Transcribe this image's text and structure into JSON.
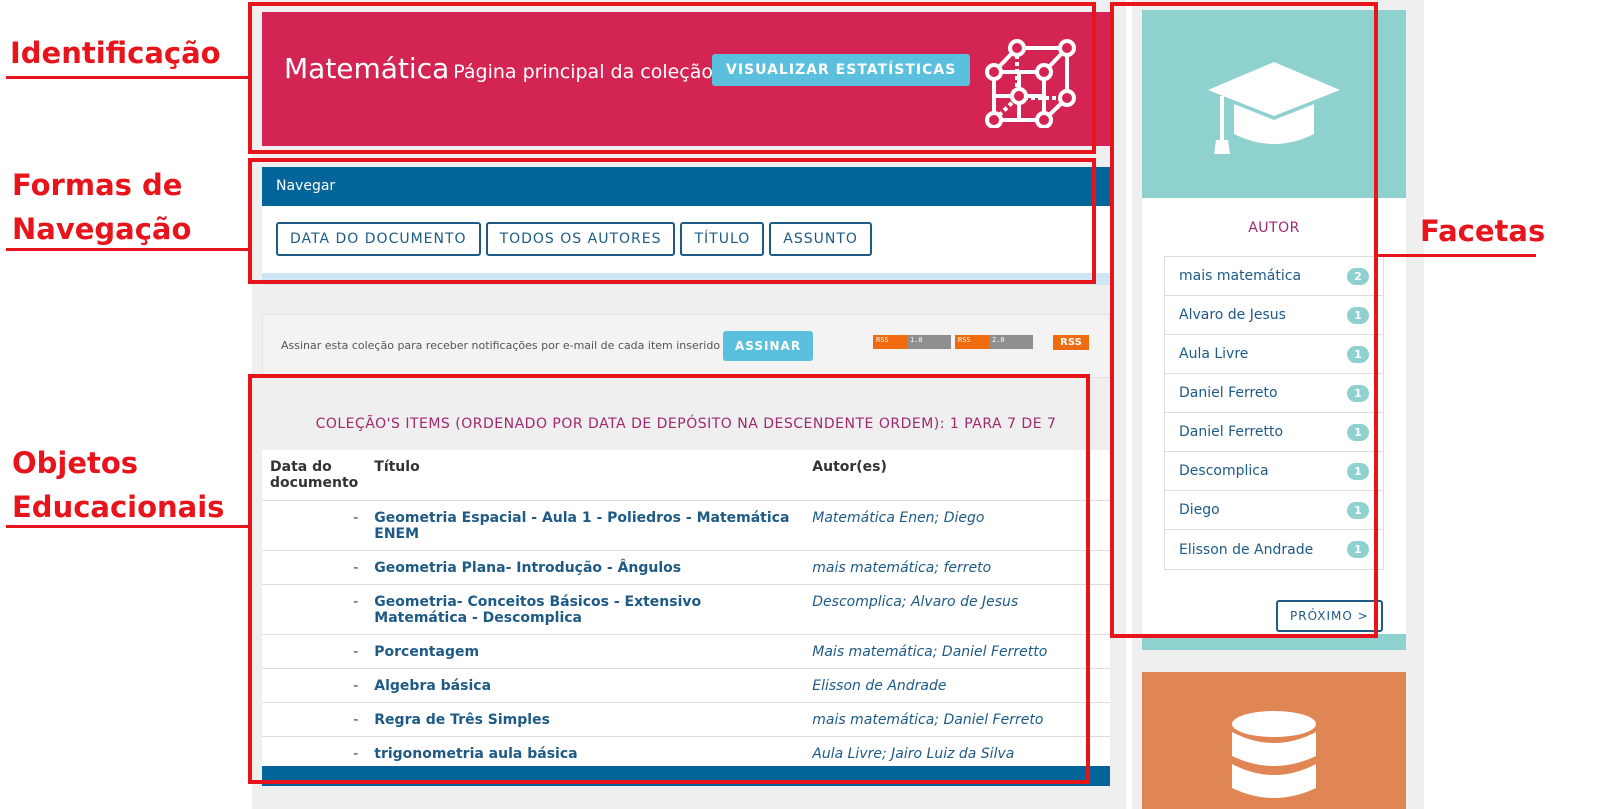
{
  "annotations": {
    "identificacao": "Identificação",
    "formas_line1": "Formas de",
    "formas_line2": "Navegação",
    "objetos_line1": "Objetos",
    "objetos_line2": "Educacionais",
    "facetas": "Facetas"
  },
  "banner": {
    "title": "Matemática",
    "subtitle": "Página principal da coleção",
    "stats_button": "VISUALIZAR ESTATÍSTICAS",
    "bg_color": "#d42453",
    "icon": "cube-network-icon"
  },
  "navigation": {
    "header": "Navegar",
    "buttons": [
      "DATA DO DOCUMENTO",
      "TODOS OS AUTORES",
      "TÍTULO",
      "ASSUNTO"
    ]
  },
  "subscribe": {
    "text": "Assinar esta coleção para receber notificações por e-mail de cada item inserido",
    "button": "ASSINAR",
    "rss1_a": "RSS",
    "rss1_b": "1.0",
    "rss2_a": "RSS",
    "rss2_b": "2.0",
    "rss_plain": "RSS"
  },
  "items": {
    "title": "COLEÇÃO'S ITEMS (ORDENADO POR DATA DE DEPÓSITO NA DESCENDENTE ORDEM): 1 PARA 7 DE 7",
    "headers": {
      "date_line1": "Data do",
      "date_line2": "documento",
      "title": "Título",
      "authors": "Autor(es)"
    },
    "rows": [
      {
        "date": "-",
        "title": "Geometria Espacial - Aula 1 - Poliedros - Matemática ENEM",
        "authors": "Matemática Enen; Diego"
      },
      {
        "date": "-",
        "title": "Geometria Plana- Introdução - Ângulos",
        "authors": "mais matemática; ferreto"
      },
      {
        "date": "-",
        "title": "Geometria- Conceitos Básicos - Extensivo Matemática - Descomplica",
        "authors": "Descomplica; Alvaro de Jesus"
      },
      {
        "date": "-",
        "title": "Porcentagem",
        "authors": "Mais matemática; Daniel Ferretto"
      },
      {
        "date": "-",
        "title": "Algebra básica",
        "authors": "Elisson de Andrade"
      },
      {
        "date": "-",
        "title": "Regra de Três Simples",
        "authors": "mais matemática; Daniel Ferreto"
      },
      {
        "date": "-",
        "title": "trigonometria aula básica",
        "authors": "Aula Livre; Jairo Luiz da Silva"
      }
    ]
  },
  "facets": {
    "title": "AUTOR",
    "icon": "graduation-cap-icon",
    "items": [
      {
        "label": "mais matemática",
        "count": "2"
      },
      {
        "label": "Alvaro de Jesus",
        "count": "1"
      },
      {
        "label": "Aula Livre",
        "count": "1"
      },
      {
        "label": "Daniel Ferreto",
        "count": "1"
      },
      {
        "label": "Daniel Ferretto",
        "count": "1"
      },
      {
        "label": "Descomplica",
        "count": "1"
      },
      {
        "label": "Diego",
        "count": "1"
      },
      {
        "label": "Elisson de Andrade",
        "count": "1"
      }
    ],
    "next_button": "PRÓXIMO >",
    "accent_color": "#8ed1ce"
  },
  "second_card": {
    "icon": "database-icon",
    "bg_color": "#e08654"
  }
}
